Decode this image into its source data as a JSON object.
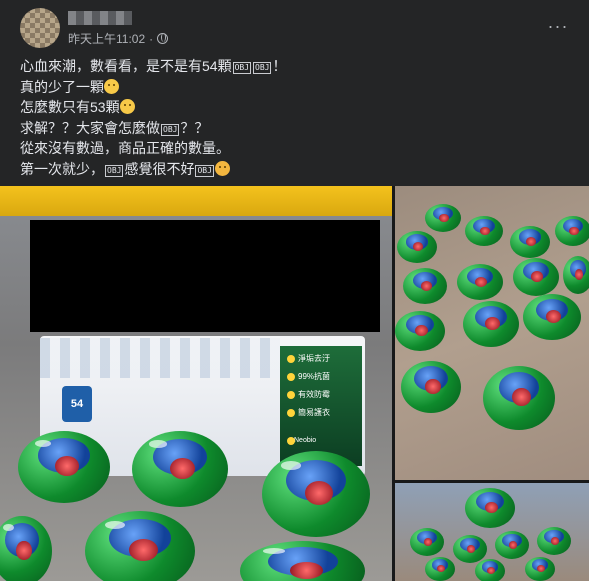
{
  "header": {
    "timestamp": "昨天上午11:02",
    "privacy_separator": "·",
    "more_label": "···"
  },
  "post": {
    "lines": [
      {
        "text": "心血來潮，數看看，是不是有54顆",
        "tail_boxes": [
          "OBJ",
          "OBJ"
        ],
        "tail_text": "！"
      },
      {
        "text": "真的少了一顆",
        "emoji": "sad-face"
      },
      {
        "text": "怎麼數只有53顆",
        "emoji": "sad-face"
      },
      {
        "text": "求解？？大家會怎麼做",
        "tail_boxes": [
          "OBJ"
        ],
        "tail_text": "？？"
      },
      {
        "text": "從來沒有數過，商品正確的數量。"
      },
      {
        "text": "第一次就少，",
        "mid_box": "OBJ",
        "mid_text": "感覺很不好",
        "end_box": "OBJ",
        "emoji": "scared-face"
      }
    ]
  },
  "photo": {
    "box_count": "54",
    "box_features": [
      "淨垢去汙",
      "99%抗菌",
      "有效防霉",
      "簡易護衣"
    ],
    "brand": "Neobio"
  },
  "colors": {
    "background": "#242526",
    "text": "#e4e6eb",
    "secondary_text": "#b0b3b8"
  },
  "icons": {
    "privacy": "globe-icon",
    "more": "more-options-icon"
  }
}
